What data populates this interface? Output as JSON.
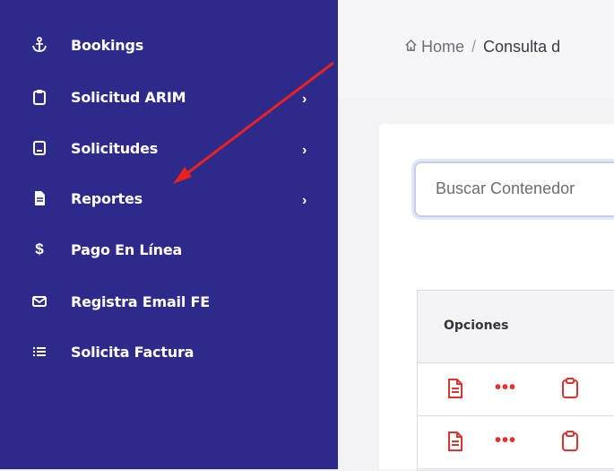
{
  "sidebar": {
    "items": [
      {
        "label": "Bookings",
        "icon": "anchor-icon",
        "has_chevron": false
      },
      {
        "label": "Solicitud ARIM",
        "icon": "clipboard-icon",
        "has_chevron": true
      },
      {
        "label": "Solicitudes",
        "icon": "tablet-icon",
        "has_chevron": true
      },
      {
        "label": "Reportes",
        "icon": "document-icon",
        "has_chevron": true
      },
      {
        "label": "Pago En Línea",
        "icon": "dollar-icon",
        "has_chevron": false
      },
      {
        "label": "Registra Email FE",
        "icon": "envelope-icon",
        "has_chevron": false
      },
      {
        "label": "Solicita Factura",
        "icon": "list-icon",
        "has_chevron": false
      }
    ],
    "chevron": "›",
    "colors": {
      "background": "#2e2a8c",
      "text": "#ffffff"
    }
  },
  "breadcrumb": {
    "home": "Home",
    "separator": "/",
    "current": "Consulta d"
  },
  "search": {
    "placeholder": "Buscar Contenedor"
  },
  "table": {
    "header": "Opciones",
    "row_icons": [
      "document-icon",
      "more-icon",
      "clipboard-icon"
    ],
    "more_glyph": "•••",
    "rows": 2
  },
  "annotation": {
    "arrow_color": "#e8231f"
  }
}
